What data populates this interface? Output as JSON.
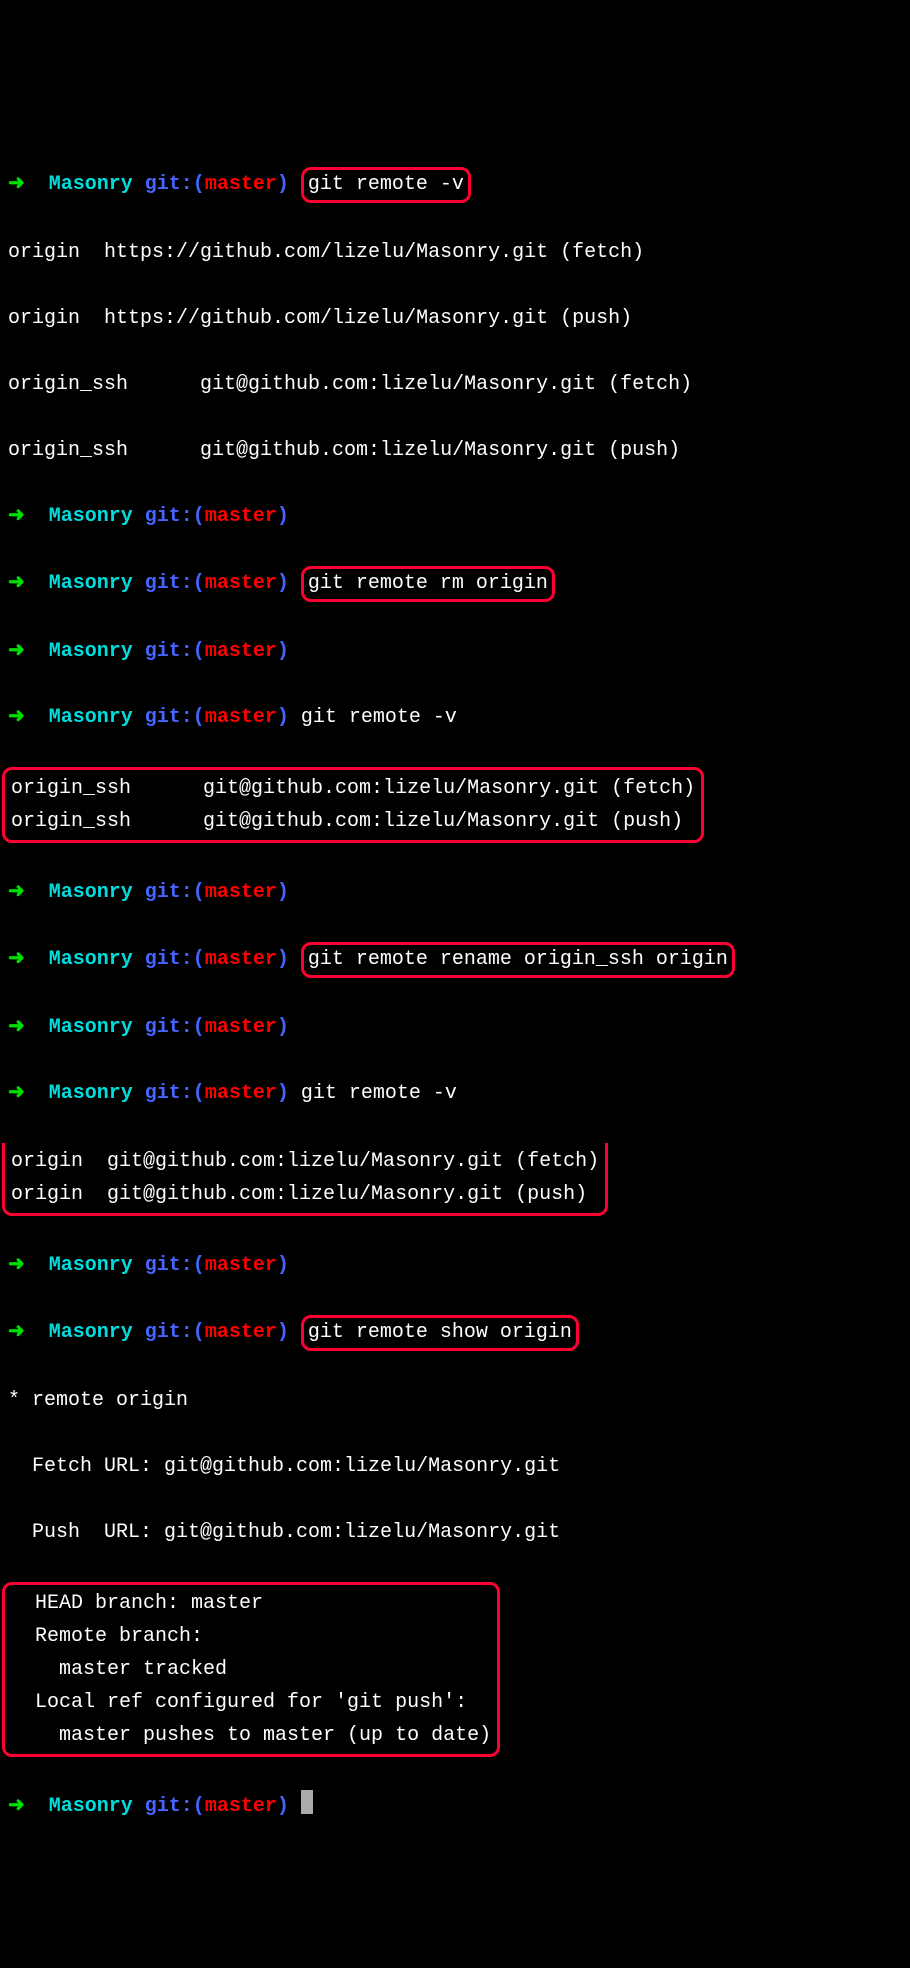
{
  "prompt": {
    "arrow": "➜ ",
    "dir": " Masonry",
    "git": " git:",
    "openParen": "(",
    "branch": "master",
    "closeParen": ")"
  },
  "commands": {
    "remoteV": "git remote -v",
    "remoteRm": "git remote rm origin",
    "remoteRename": "git remote rename origin_ssh origin",
    "remoteShow": "git remote show origin"
  },
  "output": {
    "block1": {
      "l1": "origin  https://github.com/lizelu/Masonry.git (fetch)",
      "l2": "origin  https://github.com/lizelu/Masonry.git (push)",
      "l3": "origin_ssh      git@github.com:lizelu/Masonry.git (fetch)",
      "l4": "origin_ssh      git@github.com:lizelu/Masonry.git (push)"
    },
    "block2": {
      "l1": "origin_ssh      git@github.com:lizelu/Masonry.git (fetch)",
      "l2": "origin_ssh      git@github.com:lizelu/Masonry.git (push)"
    },
    "block3": {
      "l1": "origin  git@github.com:lizelu/Masonry.git (fetch)",
      "l2": "origin  git@github.com:lizelu/Masonry.git (push)"
    },
    "show": {
      "l1": "* remote origin",
      "l2": "  Fetch URL: git@github.com:lizelu/Masonry.git",
      "l3": "  Push  URL: git@github.com:lizelu/Masonry.git",
      "l4": "  HEAD branch: master",
      "l5": "  Remote branch:",
      "l6": "    master tracked",
      "l7": "  Local ref configured for 'git push':",
      "l8": "    master pushes to master (up to date)"
    }
  }
}
